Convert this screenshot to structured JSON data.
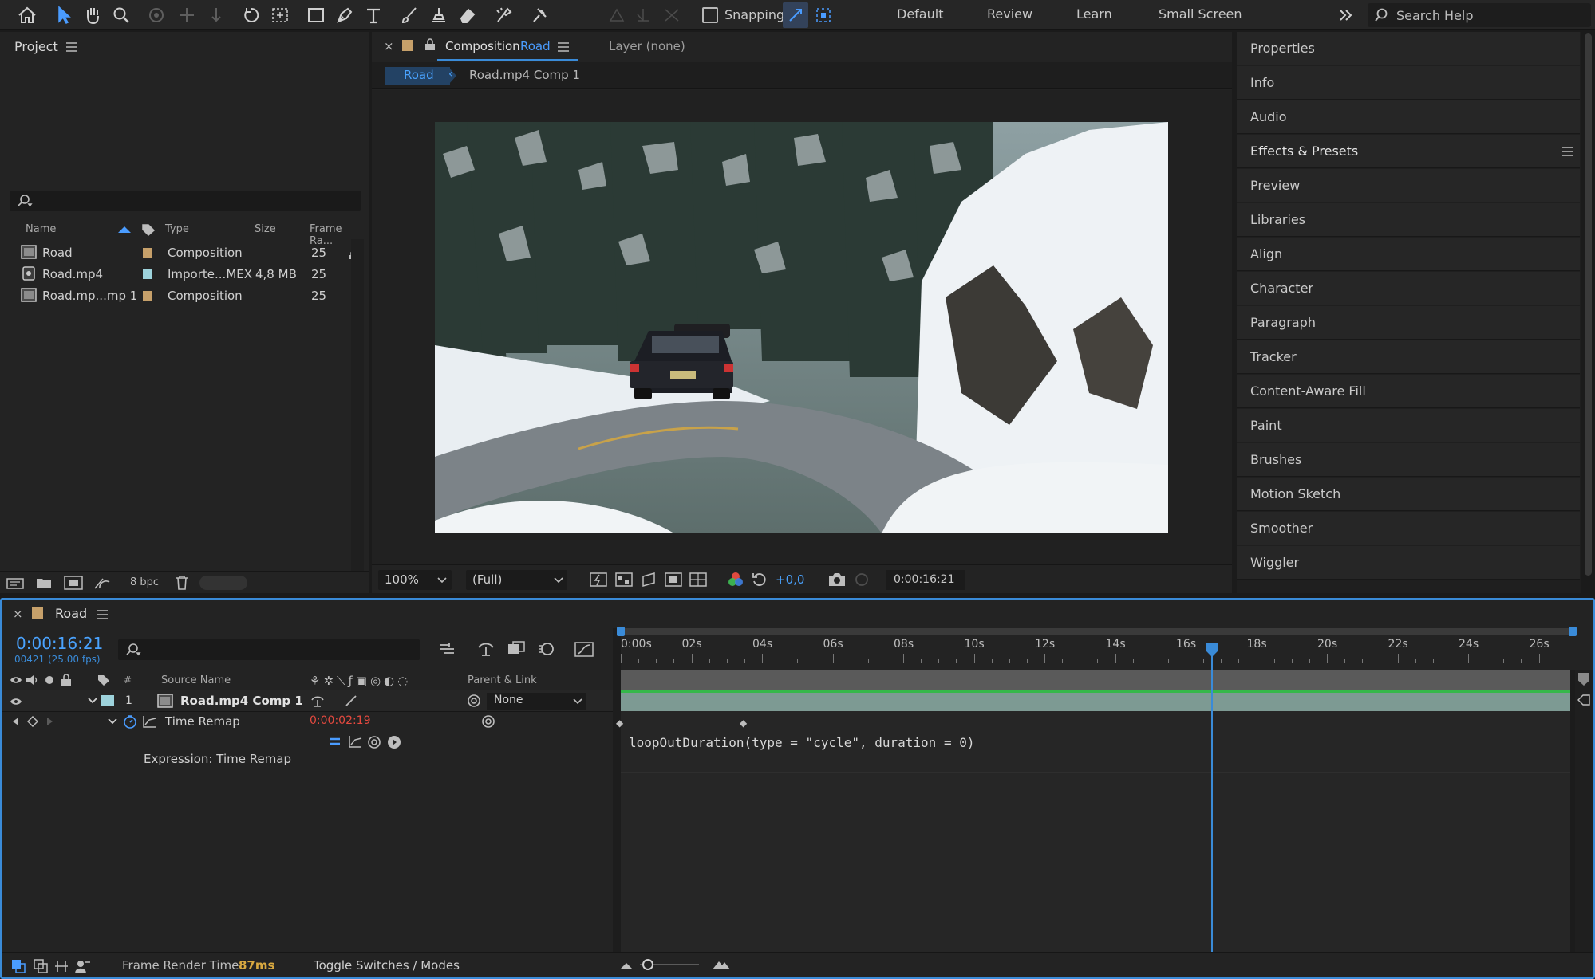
{
  "toolbar": {
    "snapping_label": "Snapping",
    "workspaces": [
      "Default",
      "Review",
      "Learn",
      "Small Screen"
    ],
    "search_placeholder": "Search Help"
  },
  "project": {
    "title": "Project",
    "columns": {
      "name": "Name",
      "type": "Type",
      "size": "Size",
      "frame_rate": "Frame Ra..."
    },
    "items": [
      {
        "name": "Road",
        "type": "Composition",
        "size": "",
        "fps": "25",
        "swatch": "#c6a06a"
      },
      {
        "name": "Road.mp4",
        "type": "Importe...MEX",
        "size": "4,8 MB",
        "fps": "25",
        "swatch": "#9ed3dc"
      },
      {
        "name": "Road.mp...mp 1",
        "type": "Composition",
        "size": "",
        "fps": "25",
        "swatch": "#c6a06a"
      }
    ],
    "bpc": "8 bpc"
  },
  "comp": {
    "tab_prefix": "Composition",
    "tab_name": "Road",
    "layer_tab": "Layer (none)",
    "crumb_active": "Road",
    "crumb_next": "Road.mp4 Comp 1",
    "zoom": "100%",
    "resolution": "(Full)",
    "exposure": "+0,0",
    "timecode": "0:00:16:21"
  },
  "right_panels": [
    "Properties",
    "Info",
    "Audio",
    "Effects & Presets",
    "Preview",
    "Libraries",
    "Align",
    "Character",
    "Paragraph",
    "Tracker",
    "Content-Aware Fill",
    "Paint",
    "Brushes",
    "Motion Sketch",
    "Smoother",
    "Wiggler"
  ],
  "timeline": {
    "comp_name": "Road",
    "timecode": "0:00:16:21",
    "frame_info": "00421 (25.00 fps)",
    "cols": {
      "num": "#",
      "source": "Source Name",
      "parent": "Parent & Link"
    },
    "layer": {
      "num": "1",
      "name": "Road.mp4 Comp 1",
      "parent": "None"
    },
    "property": {
      "name": "Time Remap",
      "value": "0:00:02:19"
    },
    "expression_label": "Expression: Time Remap",
    "expression": "loopOutDuration(type = \"cycle\", duration = 0)",
    "ruler": [
      "0:00s",
      "02s",
      "04s",
      "06s",
      "08s",
      "10s",
      "12s",
      "14s",
      "16s",
      "18s",
      "20s",
      "22s",
      "24s",
      "26s"
    ],
    "render_label": "Frame Render Time",
    "render_value": "87ms",
    "toggle_label": "Toggle Switches / Modes"
  },
  "colors": {
    "accent": "#3a8bd8",
    "timecode": "#4aa3ff",
    "value_red": "#e4493f",
    "green_bar": "#35b84a",
    "layer_bar": "#7d9a93"
  }
}
